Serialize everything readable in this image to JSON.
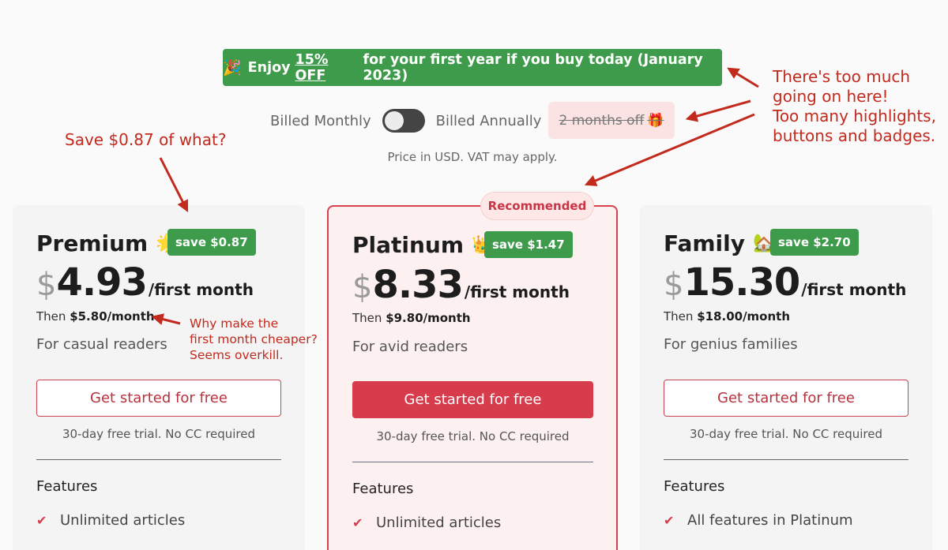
{
  "promo": {
    "emoji": "🎉",
    "prefix": "Enjoy",
    "highlight": "15% OFF",
    "suffix": "for your first year if you buy today (January 2023)"
  },
  "billing": {
    "monthly_label": "Billed Monthly",
    "annual_label": "Billed Annually",
    "toggle_state": "monthly",
    "months_off": "2 months off",
    "months_off_emoji": "🎁"
  },
  "price_note": "Price in USD. VAT may apply.",
  "recommended_label": "Recommended",
  "plans": [
    {
      "name": "Premium",
      "emoji": "🌟",
      "save": "save $0.87",
      "currency": "$",
      "price": "4.93",
      "period": "/first month",
      "then_prefix": "Then",
      "then_price": "$5.80/month",
      "audience": "For casual readers",
      "cta": "Get started for free",
      "trial": "30-day free trial. No CC required",
      "features_heading": "Features",
      "features": [
        "Unlimited articles"
      ]
    },
    {
      "name": "Platinum",
      "emoji": "👑",
      "save": "save $1.47",
      "currency": "$",
      "price": "8.33",
      "period": "/first month",
      "then_prefix": "Then",
      "then_price": "$9.80/month",
      "audience": "For avid readers",
      "cta": "Get started for free",
      "trial": "30-day free trial. No CC required",
      "features_heading": "Features",
      "features": [
        "Unlimited articles"
      ]
    },
    {
      "name": "Family",
      "emoji": "🏡",
      "save": "save $2.70",
      "currency": "$",
      "price": "15.30",
      "period": "/first month",
      "then_prefix": "Then",
      "then_price": "$18.00/month",
      "audience": "For genius families",
      "cta": "Get started for free",
      "trial": "30-day free trial. No CC required",
      "features_heading": "Features",
      "features": [
        "All features in Platinum"
      ]
    }
  ],
  "annotations": {
    "save_question": "Save $0.87 of what?",
    "first_month": [
      "Why make the",
      "first month cheaper?",
      "Seems overkill."
    ],
    "too_much": [
      "There's too much",
      "going on here!",
      "Too many highlights,",
      "buttons and badges."
    ]
  },
  "colors": {
    "accent_red": "#d63c4c",
    "badge_green": "#3f9b4c",
    "annotation_red": "#c22a1e"
  }
}
